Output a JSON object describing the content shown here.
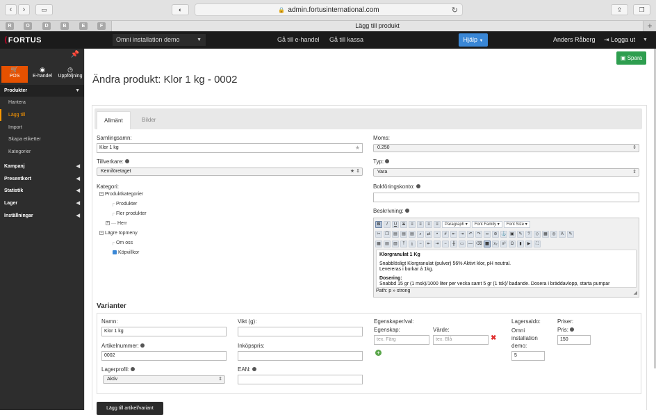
{
  "browser": {
    "url": "admin.fortusinternational.com",
    "tab_title": "Lägg till produkt",
    "favorites": [
      "R",
      "O",
      "D",
      "B",
      "E",
      "F"
    ],
    "new_tab": "+"
  },
  "topnav": {
    "logo": "FORTUS",
    "store": "Omni installation demo",
    "links": [
      "Gå till e-handel",
      "Gå till kassa"
    ],
    "help": "Hjälp",
    "user": "Anders Råberg",
    "logout": "Logga ut"
  },
  "sidebar": {
    "top": [
      {
        "label": "POS",
        "icon": "cart-icon",
        "glyph": "🛒"
      },
      {
        "label": "E-handel",
        "icon": "globe-icon",
        "glyph": "◉"
      },
      {
        "label": "Uppföljning",
        "icon": "clock-icon",
        "glyph": "◷"
      }
    ],
    "products": {
      "label": "Produkter",
      "items": [
        "Hantera",
        "Lägg till",
        "Import",
        "Skapa etiketter",
        "Kategorier"
      ]
    },
    "sections": [
      "Kampanj",
      "Presentkort",
      "Statistik",
      "Lager",
      "Inställningar"
    ]
  },
  "page": {
    "title": "Ändra produkt: Klor 1 kg - 0002",
    "save": "Spara",
    "tabs": [
      "Allmänt",
      "Bilder"
    ]
  },
  "form": {
    "samlingsamn_label": "Samlingsamn:",
    "samlingsamn_value": "Klor 1 kg",
    "tillverkare_label": "Tillverkare:",
    "tillverkare_value": "Kemiföretaget",
    "kategori_label": "Kategori:",
    "categories": [
      {
        "label": "Produktkategorier",
        "type": "minus"
      },
      {
        "label": "Produkter",
        "type": "leaf"
      },
      {
        "label": "Fler produkter",
        "type": "leaf"
      },
      {
        "label": "Herr",
        "type": "plus"
      },
      {
        "label": "Lägre topmeny",
        "type": "minus"
      },
      {
        "label": "Om oss",
        "type": "leaf"
      },
      {
        "label": "Köpvillkor",
        "type": "checked"
      }
    ],
    "moms_label": "Moms:",
    "moms_value": "0.250",
    "typ_label": "Typ:",
    "typ_value": "Vara",
    "bokforing_label": "Bokföringskonto:",
    "bokforing_value": "",
    "beskrivning_label": "Beskrivning:"
  },
  "editor": {
    "paragraph": "Paragraph",
    "font_family": "Font Family",
    "font_size": "Font Size",
    "heading1": "Klorgranulat 1 Kg",
    "line1": "Snabblösligt Klorgranulat (pulver) 56% Aktivt klor, pH neutral.",
    "line2": "Levereras i burkar á 1kg.",
    "heading2": "Dosering:",
    "line3": "Snabbd 15 gr (1 msk)/1000 liter per vecka samt 5 gr (1 tsk)/ badande. Dosera i bräddavlopp, starta pumpar",
    "path": "Path: p » strong"
  },
  "variants": {
    "heading": "Varianter",
    "namn_label": "Namn:",
    "namn_value": "Klor 1 kg",
    "artikel_label": "Artikelnummer:",
    "artikel_value": "0002",
    "lagerprofil_label": "Lagerprofil:",
    "lagerprofil_value": "Aktiv",
    "vikt_label": "Vikt (g):",
    "inkopspris_label": "Inköpspris:",
    "ean_label": "EAN:",
    "egenskaper_label": "Egenskaper/val:",
    "egenskap_label": "Egenskap:",
    "egenskap_placeholder": "tex. Färg",
    "varde_label": "Värde:",
    "varde_placeholder": "tex. Blå",
    "lagersaldo_label": "Lagersaldo:",
    "store_label": "Omni installation demo:",
    "lagersaldo_value": "5",
    "priser_label": "Priser:",
    "pris_label": "Pris:",
    "pris_value": "150",
    "add_button": "Lägg till artikel/variant"
  },
  "colors": {
    "accent_orange": "#e65100",
    "save_green": "#2e9e4f",
    "help_blue": "#3a87d6",
    "nav_dark": "#1b1b1b",
    "sidebar": "#2d2d2d"
  }
}
